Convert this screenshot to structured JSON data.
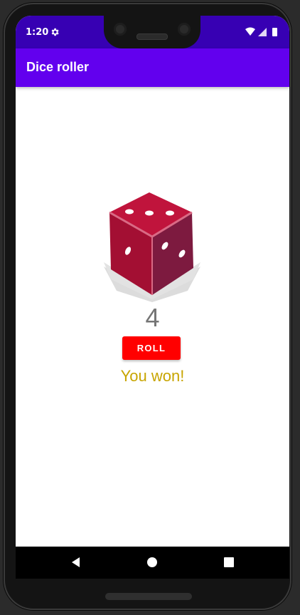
{
  "status_bar": {
    "time": "1:20",
    "icons": [
      "gear-icon",
      "wifi-icon",
      "signal-icon",
      "battery-icon"
    ],
    "color": "#3700b3"
  },
  "app_bar": {
    "title": "Dice roller",
    "color": "#6200ee"
  },
  "dice": {
    "icon": "dice-icon",
    "face_color": "#c0143c"
  },
  "result": {
    "value": "4"
  },
  "roll_button": {
    "label": "ROLL",
    "color": "#ff0000"
  },
  "message": {
    "text": "You won!",
    "color": "#c8a500"
  },
  "nav_bar": {
    "icons": [
      "back-icon",
      "home-icon",
      "recents-icon"
    ]
  }
}
